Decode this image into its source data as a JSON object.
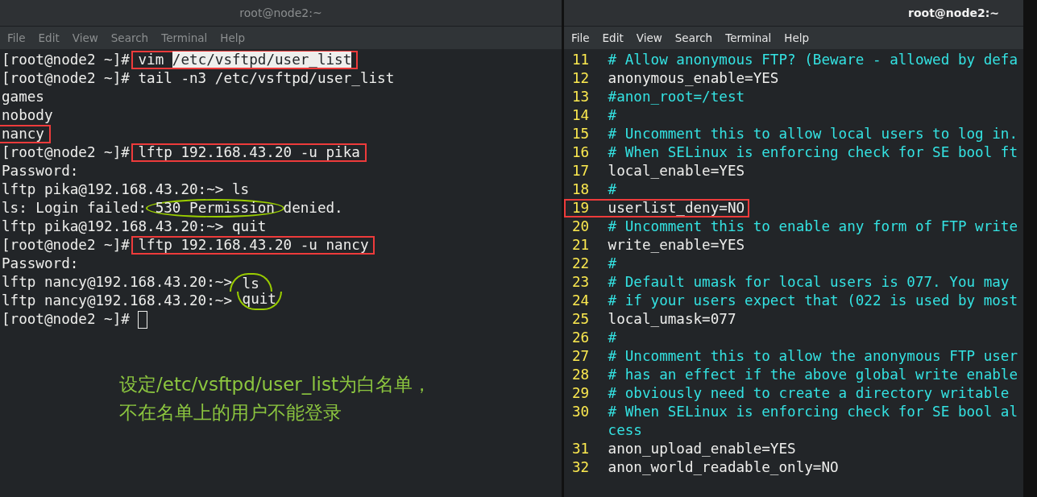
{
  "windows": [
    {
      "title": "root@node2:~",
      "focused": false,
      "menu": [
        "File",
        "Edit",
        "View",
        "Search",
        "Terminal",
        "Help"
      ],
      "lines": [
        [
          {
            "text": "[root@node2 ~]# "
          },
          {
            "boxed": true,
            "parts": [
              {
                "text": "vim ",
                "highlighted": false
              },
              {
                "text": "/etc/vsftpd/user_list",
                "highlighted": true
              }
            ]
          }
        ],
        [
          {
            "text": "[root@node2 ~]# tail -n3 /etc/vsftpd/user_list"
          }
        ],
        [
          {
            "text": "games"
          }
        ],
        [
          {
            "text": "nobody"
          }
        ],
        [
          {
            "boxed": true,
            "text": "nancy"
          }
        ],
        [
          {
            "text": "[root@node2 ~]# "
          },
          {
            "boxed": true,
            "text": "lftp 192.168.43.20 -u pika"
          }
        ],
        [
          {
            "text": "Password:"
          }
        ],
        [
          {
            "text": "lftp pika@192.168.43.20:~> ls"
          }
        ],
        [
          {
            "text": "ls: Login failed: "
          },
          {
            "circled": true,
            "text": "530 Permission"
          },
          {
            "text": " denied."
          }
        ],
        [
          {
            "text": "lftp pika@192.168.43.20:~> quit"
          }
        ],
        [
          {
            "text": "[root@node2 ~]# "
          },
          {
            "boxed": true,
            "text": "lftp 192.168.43.20 -u nancy"
          }
        ],
        [
          {
            "text": "Password:"
          }
        ],
        [
          {
            "text": "lftp nancy@192.168.43.20:~> "
          },
          {
            "circled": true,
            "text": "ls"
          }
        ],
        [
          {
            "text": "lftp nancy@192.168.43.20:~> "
          },
          {
            "circled": true,
            "text": "quit"
          }
        ],
        [
          {
            "text": "[root@node2 ~]# "
          },
          {
            "kind": "cursor"
          }
        ]
      ],
      "caption": [
        "设定/etc/vsftpd/user_list为白名单，",
        "不在名单上的用户不能登录"
      ]
    },
    {
      "title": "root@node2:~",
      "focused": true,
      "menu": [
        "File",
        "Edit",
        "View",
        "Search",
        "Terminal",
        "Help"
      ],
      "code": [
        {
          "number": "11",
          "kind": "comment",
          "text": "# Allow anonymous FTP? (Beware - allowed by defa"
        },
        {
          "number": "12",
          "kind": "setting",
          "text": "anonymous_enable=YES"
        },
        {
          "number": "13",
          "kind": "comment",
          "text": "#anon_root=/test"
        },
        {
          "number": "14",
          "kind": "comment",
          "text": "#"
        },
        {
          "number": "15",
          "kind": "comment",
          "text": "# Uncomment this to allow local users to log in."
        },
        {
          "number": "16",
          "kind": "comment",
          "text": "# When SELinux is enforcing check for SE bool ft"
        },
        {
          "number": "17",
          "kind": "setting",
          "text": "local_enable=YES"
        },
        {
          "number": "18",
          "kind": "comment",
          "text": "#"
        },
        {
          "number": "19",
          "kind": "setting",
          "text": "userlist_deny=NO",
          "boxed": true
        },
        {
          "number": "20",
          "kind": "comment",
          "text": "# Uncomment this to enable any form of FTP write"
        },
        {
          "number": "21",
          "kind": "setting",
          "text": "write_enable=YES"
        },
        {
          "number": "22",
          "kind": "comment",
          "text": "#"
        },
        {
          "number": "23",
          "kind": "comment",
          "text": "# Default umask for local users is 077. You may"
        },
        {
          "number": "24",
          "kind": "comment",
          "text": "# if your users expect that (022 is used by most"
        },
        {
          "number": "25",
          "kind": "setting",
          "text": "local_umask=077"
        },
        {
          "number": "26",
          "kind": "comment",
          "text": "#"
        },
        {
          "number": "27",
          "kind": "comment",
          "text": "# Uncomment this to allow the anonymous FTP user"
        },
        {
          "number": "28",
          "kind": "comment",
          "text": "# has an effect if the above global write enable"
        },
        {
          "number": "29",
          "kind": "comment",
          "text": "# obviously need to create a directory writable"
        },
        {
          "number": "30",
          "kind": "comment",
          "text": "# When SELinux is enforcing check for SE bool al"
        },
        {
          "kind": "comment",
          "text": "cess"
        },
        {
          "number": "31",
          "kind": "setting",
          "text": "anon_upload_enable=YES"
        },
        {
          "number": "32",
          "kind": "setting",
          "text": "anon_world_readable_only=NO"
        }
      ]
    }
  ]
}
